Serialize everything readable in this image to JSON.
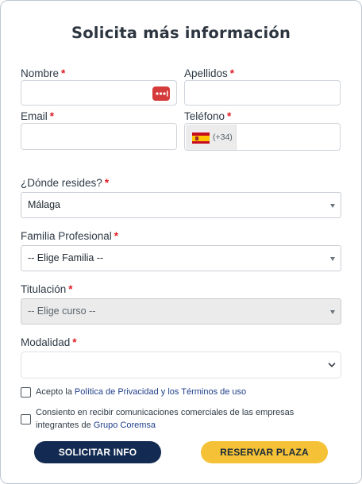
{
  "form": {
    "title": "Solicita más información",
    "required_mark": "*",
    "fields": {
      "nombre": {
        "label": "Nombre",
        "value": ""
      },
      "apellidos": {
        "label": "Apellidos",
        "value": ""
      },
      "email": {
        "label": "Email",
        "value": ""
      },
      "telefono": {
        "label": "Teléfono",
        "dial_code": "(+34)",
        "country": "Spain",
        "value": ""
      },
      "residencia": {
        "label": "¿Dónde resides?",
        "selected": "Málaga"
      },
      "familia": {
        "label": "Familia Profesional",
        "selected": "-- Elige Familia --"
      },
      "titulacion": {
        "label": "Titulación",
        "selected": "-- Elige curso --",
        "disabled": true
      },
      "modalidad": {
        "label": "Modalidad",
        "selected": ""
      }
    },
    "consents": {
      "privacy": {
        "prefix": "Acepto la ",
        "link_text": "Política de Privacidad y los Términos de uso",
        "checked": false
      },
      "marketing": {
        "line1": "Consiento en recibir comunicaciones comerciales de las empresas",
        "line2_prefix": "integrantes de ",
        "link_text": "Grupo Coremsa",
        "checked": false
      }
    },
    "buttons": {
      "info_label": "SOLICITAR INFO",
      "reserve_label": "RESERVAR PLAZA"
    },
    "password_manager_badge": "•••|",
    "colors": {
      "required": "#e01b22",
      "primary_button": "#132b52",
      "secondary_button": "#f5c136",
      "link": "#1f3f8a"
    }
  }
}
